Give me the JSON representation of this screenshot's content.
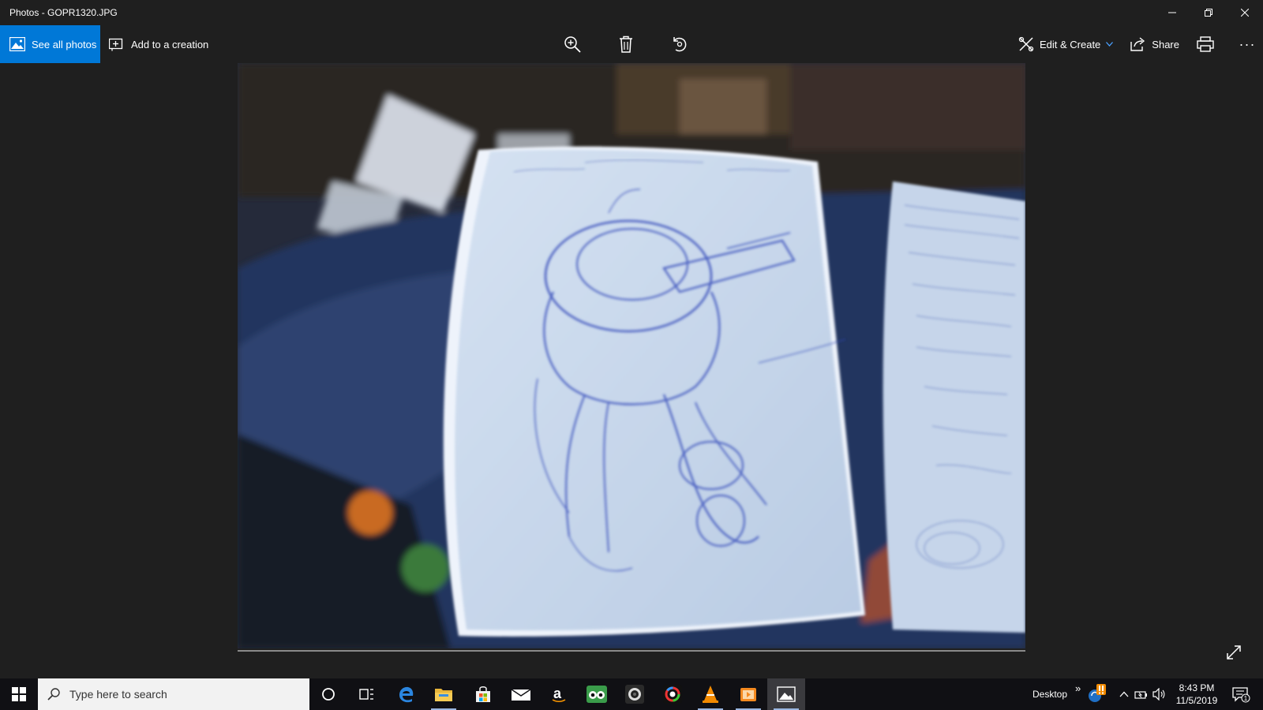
{
  "window": {
    "title": "Photos - GOPR1320.JPG"
  },
  "toolbar": {
    "see_all_label": "See all photos",
    "add_creation_label": "Add to a creation",
    "edit_create_label": "Edit & Create",
    "share_label": "Share",
    "more_label": "···"
  },
  "taskbar": {
    "search_placeholder": "Type here to search",
    "desktop_label": "Desktop",
    "chevron_label": "»",
    "time": "8:43 PM",
    "date": "11/5/2019",
    "notification_count": "1"
  },
  "colors": {
    "accent": "#0078d7",
    "background": "#1f1f1f",
    "taskbar": "#101014"
  }
}
